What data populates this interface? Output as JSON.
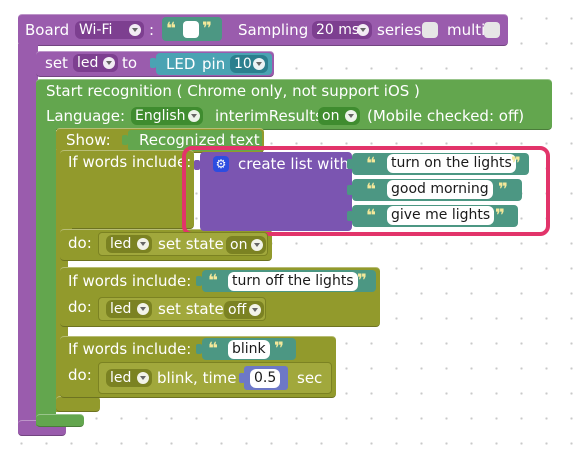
{
  "board": {
    "label": "Board",
    "value": "Wi-Fi",
    "colon": ":",
    "sampling_label": "Sampling",
    "sampling_value": "20 ms",
    "series_label": "series",
    "multi_label": "multi"
  },
  "set_led": {
    "set_label": "set",
    "var": "led",
    "to_label": "to",
    "led_label": "LED",
    "pin_label": "pin",
    "pin_value": "10"
  },
  "recognition": {
    "title": "Start recognition ( Chrome only, not support iOS )",
    "language_label": "Language:",
    "language_value": "English",
    "interim_label": "interimResults:",
    "interim_value": "on",
    "mobile_note": "(Mobile checked: off)",
    "show_label": "Show:",
    "show_value": "Recognized text"
  },
  "rules": [
    {
      "if_label": "If words include:",
      "list_label": "create list with",
      "words": [
        "turn on the lights",
        "good morning",
        "give me lights"
      ],
      "do_label": "do:",
      "var": "led",
      "action_label": "set state",
      "action_value": "on"
    },
    {
      "if_label": "If words include:",
      "words": [
        "turn off the lights"
      ],
      "do_label": "do:",
      "var": "led",
      "action_label": "set state",
      "action_value": "off"
    },
    {
      "if_label": "If words include:",
      "words": [
        "blink"
      ],
      "do_label": "do:",
      "var": "led",
      "action_label": "blink, time",
      "time_value": "0.5",
      "unit_label": "sec"
    }
  ],
  "glyphs": {
    "quote_open": "❝",
    "quote_close": "❞",
    "gear": "⚙"
  },
  "colors": {
    "board_block": "#9a5cad",
    "recognition_block": "#63a64e",
    "rule_block": "#929a2c",
    "text_block": "#4c9783",
    "list_block": "#7b55b1",
    "highlight": "#e2346a"
  }
}
